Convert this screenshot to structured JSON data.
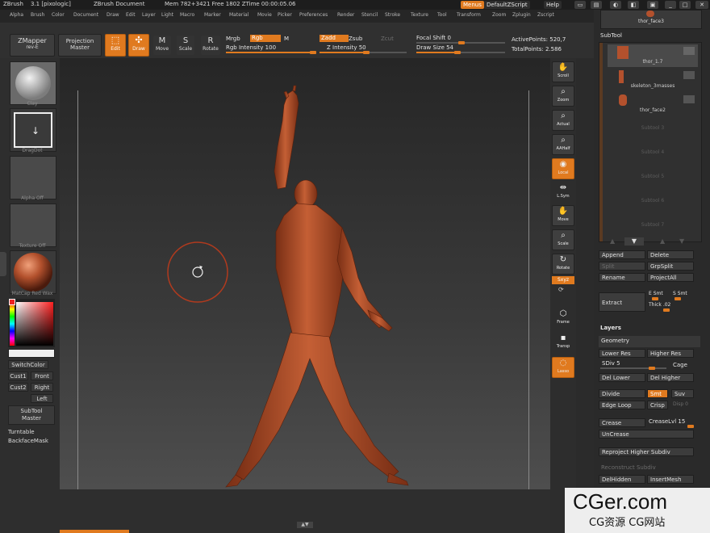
{
  "titlebar": {
    "app": "ZBrush",
    "version": "3.1 [pixologic]",
    "doc": "ZBrush Document",
    "mem": "Mem 782+3421  Free 1802  ZTime 00:00:05.06",
    "menus_btn": "Menus",
    "script_btn": "DefaultZScript",
    "help_btn": "Help"
  },
  "menubar": [
    "Alpha",
    "Brush",
    "Color",
    "Document",
    "Draw",
    "Edit",
    "Layer",
    "Light",
    "Macro",
    "Marker",
    "Material",
    "Movie",
    "Picker",
    "Preferences",
    "Render",
    "Stencil",
    "Stroke",
    "Texture",
    "Tool",
    "Transform",
    "Zoom",
    "Zplugin",
    "Zscript"
  ],
  "toolbar": {
    "zmapper": "ZMapper",
    "zmapper_sub": "rev-E",
    "projection": "Projection",
    "projection_sub": "Master",
    "edit": "Edit",
    "draw": "Draw",
    "move": "Move",
    "scale": "Scale",
    "rotate": "Rotate",
    "mrgb": "Mrgb",
    "rgb": "Rgb",
    "m": "M",
    "rgb_intensity": "Rgb Intensity 100",
    "zadd": "Zadd",
    "zsub": "Zsub",
    "zcut": "Zcut",
    "z_intensity": "Z Intensity 50",
    "focal_shift": "Focal Shift 0",
    "draw_size": "Draw Size 54",
    "active_points": "ActivePoints: 520,7",
    "total_points": "TotalPoints: 2.586"
  },
  "lefttray": {
    "brush_cap": "Clay",
    "stroke_cap": "DragDot",
    "alpha_cap": "Alpha  Off",
    "texture_cap": "Texture  Off",
    "material_cap": "MatCap  Red  Wax",
    "switchcolor": "SwitchColor",
    "cust1": "Cust1",
    "front": "Front",
    "cust2": "Cust2",
    "right": "Right",
    "left": "Left",
    "subtool_master": "SubTool",
    "subtool_master_sub": "Master",
    "turntable": "Turntable",
    "backfacemask": "BackfaceMask"
  },
  "rightshelf": [
    "Scroll",
    "Zoom",
    "Actual",
    "AAHalf",
    "Local",
    "L.Sym",
    "Move",
    "Scale",
    "Rotate",
    "Frame",
    "Transp",
    "Lasso"
  ],
  "xyz_label": "Sxyz",
  "rightpanel": {
    "top_tool": "thor_face3",
    "subtool_header": "SubTool",
    "subtools": [
      "thor_1.7",
      "skeleton_3masses",
      "thor_face2",
      "Subtool 3",
      "Subtool 4",
      "Subtool 5",
      "Subtool 6",
      "Subtool 7"
    ],
    "append": "Append",
    "delete": "Delete",
    "split": "Split",
    "grpsplit": "GrpSplit",
    "rename": "Rename",
    "projectall": "ProjectAll",
    "extract": "Extract",
    "esmt": "E Smt",
    "ssmt": "S Smt",
    "thick": "Thick .02",
    "layers": "Layers",
    "geometry": "Geometry",
    "lower_res": "Lower Res",
    "higher_res": "Higher Res",
    "sdiv": "SDiv 5",
    "cage": "Cage",
    "del_lower": "Del Lower",
    "del_higher": "Del Higher",
    "divide": "Divide",
    "smt": "Smt",
    "suv": "Suv",
    "edge_loop": "Edge Loop",
    "crisp": "Crisp",
    "disp": "Disp 0",
    "crease": "Crease",
    "creaselvl": "CreaseLvl 15",
    "uncrease": "UnCrease",
    "reproject": "Reproject Higher Subdiv",
    "reconstruct": "Reconstruct Subdiv",
    "delhidden": "DelHidden",
    "insertmesh": "InsertMesh"
  },
  "watermark": {
    "brand": "CGer.com",
    "sub": "CG资源  CG网站"
  },
  "colors": {
    "accent": "#e07a1f",
    "skin": "#b3512d",
    "panel": "#2a2a2a"
  }
}
